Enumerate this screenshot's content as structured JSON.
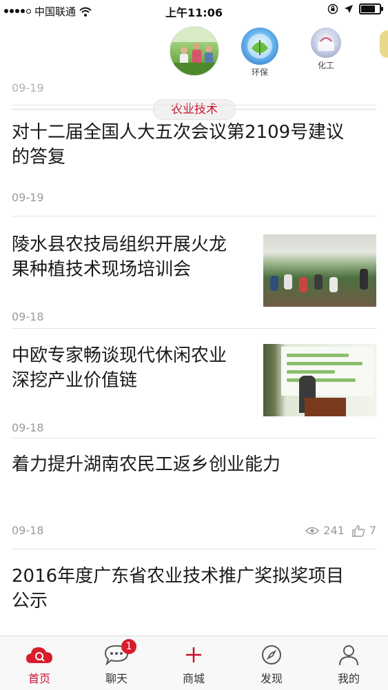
{
  "status_bar": {
    "carrier": "中国联通",
    "time": "上午11:06"
  },
  "categories": {
    "active": "农业技术",
    "items": [
      {
        "label": ""
      },
      {
        "label": "环保"
      },
      {
        "label": "化工"
      },
      {
        "label": ""
      }
    ]
  },
  "feed": {
    "clipped_date": "09-19",
    "items": [
      {
        "title_line1": "对十二届全国人大五次会议第2109号建议",
        "title_line2": "的答复",
        "date": "09-19"
      },
      {
        "title_line1": "陵水县农技局组织开展火龙",
        "title_line2": "果种植技术现场培训会",
        "date": "09-18"
      },
      {
        "title_line1": "中欧专家畅谈现代休闲农业",
        "title_line2": "深挖产业价值链",
        "date": "09-18"
      },
      {
        "title_line1": "着力提升湖南农民工返乡创业能力",
        "title_line2": "",
        "date": "09-18",
        "views": "241",
        "likes": "7"
      },
      {
        "title_line1": "2016年度广东省农业技术推广奖拟奖项目",
        "title_line2": "公示",
        "date": ""
      }
    ]
  },
  "tabbar": {
    "tabs": [
      {
        "label": "首页"
      },
      {
        "label": "聊天",
        "badge": "1"
      },
      {
        "label": "商城"
      },
      {
        "label": "发现"
      },
      {
        "label": "我的"
      }
    ]
  },
  "colors": {
    "accent": "#c8102e",
    "badge": "#d81e2c",
    "muted": "#9a9a9a"
  }
}
